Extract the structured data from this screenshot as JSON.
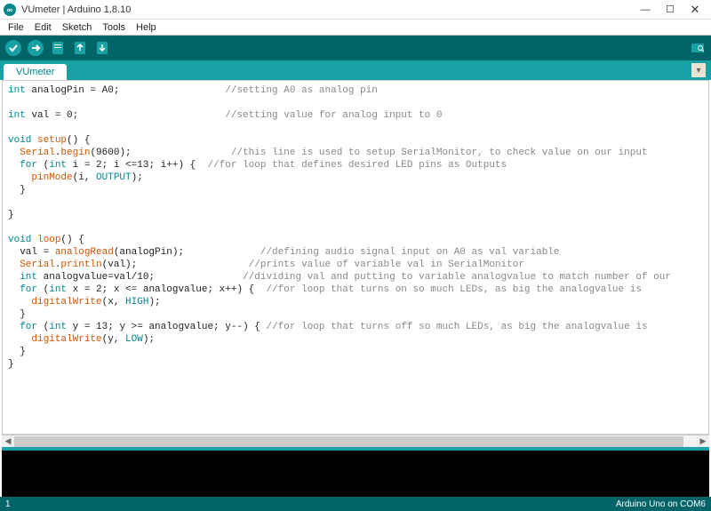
{
  "window": {
    "title": "VUmeter | Arduino 1.8.10",
    "minimize": "—",
    "maximize": "☐",
    "close": "✕"
  },
  "menu": {
    "file": "File",
    "edit": "Edit",
    "sketch": "Sketch",
    "tools": "Tools",
    "help": "Help"
  },
  "tabs": {
    "active": "VUmeter"
  },
  "status": {
    "line": "1",
    "board": "Arduino Uno on COM6"
  },
  "code": {
    "l01a": "int",
    "l01b": " analogPin = A0;                  ",
    "l01c": "//setting A0 as analog pin",
    "l02": "",
    "l03a": "int",
    "l03b": " val = 0;                         ",
    "l03c": "//setting value for analog input to 0",
    "l04": "",
    "l05a": "void",
    "l05b": " ",
    "l05c": "setup",
    "l05d": "() {",
    "l06a": "  ",
    "l06b": "Serial",
    "l06c": ".",
    "l06d": "begin",
    "l06e": "(9600);                 ",
    "l06f": "//this line is used to setup SerialMonitor, to check value on our input",
    "l07a": "  ",
    "l07b": "for",
    "l07c": " (",
    "l07d": "int",
    "l07e": " i = 2; i <=13; i++) {  ",
    "l07f": "//for loop that defines desired LED pins as Outputs",
    "l08a": "    ",
    "l08b": "pinMode",
    "l08c": "(i, ",
    "l08d": "OUTPUT",
    "l08e": ");",
    "l09": "  }",
    "l10": "",
    "l11": "}",
    "l12": "",
    "l13a": "void",
    "l13b": " ",
    "l13c": "loop",
    "l13d": "() {",
    "l14a": "  val = ",
    "l14b": "analogRead",
    "l14c": "(analogPin);             ",
    "l14d": "//defining audio signal input on A0 as val variable",
    "l15a": "  ",
    "l15b": "Serial",
    "l15c": ".",
    "l15d": "println",
    "l15e": "(val);                   ",
    "l15f": "//prints value of variable val in SerialMonitor",
    "l16a": "  ",
    "l16b": "int",
    "l16c": " analogvalue=val/10;               ",
    "l16d": "//dividing val and putting to variable analogvalue to match number of our",
    "l17a": "  ",
    "l17b": "for",
    "l17c": " (",
    "l17d": "int",
    "l17e": " x = 2; x <= analogvalue; x++) {  ",
    "l17f": "//for loop that turns on so much LEDs, as big the analogvalue is",
    "l18a": "    ",
    "l18b": "digitalWrite",
    "l18c": "(x, ",
    "l18d": "HIGH",
    "l18e": ");",
    "l19": "  }",
    "l20a": "  ",
    "l20b": "for",
    "l20c": " (",
    "l20d": "int",
    "l20e": " y = 13; y >= analogvalue; y--) { ",
    "l20f": "//for loop that turns off so much LEDs, as big the analogvalue is",
    "l21a": "    ",
    "l21b": "digitalWrite",
    "l21c": "(y, ",
    "l21d": "LOW",
    "l21e": ");",
    "l22": "  }",
    "l23": "}"
  }
}
